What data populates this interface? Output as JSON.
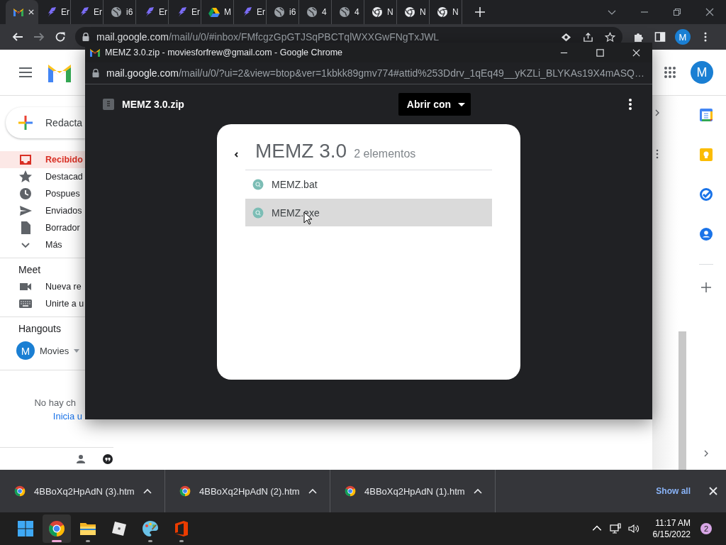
{
  "browser": {
    "tabs": [
      {
        "kind": "gmail",
        "selected": true
      },
      {
        "kind": "feather",
        "title": "Er",
        "selected": false
      },
      {
        "kind": "feather",
        "title": "Er",
        "selected": false
      },
      {
        "kind": "globe",
        "title": "i6",
        "selected": false
      },
      {
        "kind": "feather",
        "title": "Er",
        "selected": false
      },
      {
        "kind": "feather",
        "title": "Er",
        "selected": false
      },
      {
        "kind": "drive",
        "title": "M",
        "selected": false
      },
      {
        "kind": "feather",
        "title": "Er",
        "selected": false
      },
      {
        "kind": "globe",
        "title": "i6",
        "selected": false
      },
      {
        "kind": "globe",
        "title": "4",
        "selected": false
      },
      {
        "kind": "globe",
        "title": "4",
        "selected": false
      },
      {
        "kind": "chrome",
        "title": "N",
        "selected": false
      },
      {
        "kind": "chrome",
        "title": "N",
        "selected": false
      },
      {
        "kind": "chrome",
        "title": "N",
        "selected": false
      }
    ],
    "url": {
      "host": "mail.google.com",
      "path": "/mail/u/0/#inbox/FMfcgzGpGTJSqPBCTqlWXXGwFNgTxJWL"
    },
    "profile": "M"
  },
  "gmail": {
    "compose": "Redacta",
    "nav": [
      {
        "label": "Recibido",
        "kind": "inbox",
        "selected": true
      },
      {
        "label": "Destacad",
        "kind": "star",
        "selected": false
      },
      {
        "label": "Pospues",
        "kind": "clock",
        "selected": false
      },
      {
        "label": "Enviados",
        "kind": "send",
        "selected": false
      },
      {
        "label": "Borrador",
        "kind": "draft",
        "selected": false
      },
      {
        "label": "Más",
        "kind": "chevron",
        "selected": false
      }
    ],
    "meet": {
      "heading": "Meet",
      "items": [
        {
          "label": "Nueva re",
          "kind": "video"
        },
        {
          "label": "Unirte a u",
          "kind": "keyboard"
        }
      ]
    },
    "hangouts": {
      "heading": "Hangouts",
      "user_initial": "M",
      "user": "Movies",
      "empty_text": "No hay ch",
      "link": "Inicia u"
    },
    "account_initial": "M"
  },
  "popup": {
    "title": "MEMZ 3.0.zip - moviesforfrew@gmail.com - Google Chrome",
    "url": {
      "host": "mail.google.com",
      "path": "/mail/u/0/?ui=2&view=btop&ver=1kbkk89gmv774#attid%253Ddrv_1qEq49__yKZLi_BLYKAs19X4mASQ…"
    },
    "file_name": "MEMZ 3.0.zip",
    "open_with": "Abrir con",
    "folder": {
      "name": "MEMZ 3.0",
      "count": "2 elementos",
      "items": [
        {
          "name": "MEMZ.bat",
          "selected": false
        },
        {
          "name": "MEMZ.exe",
          "selected": true
        }
      ]
    }
  },
  "downloads": {
    "items": [
      "4BBoXq2HpAdN (3).htm",
      "4BBoXq2HpAdN (2).htm",
      "4BBoXq2HpAdN (1).htm"
    ],
    "show_all": "Show all"
  },
  "taskbar": {
    "apps": [
      {
        "kind": "start",
        "selected": false,
        "running": false
      },
      {
        "kind": "chrome",
        "selected": true,
        "running": true
      },
      {
        "kind": "folder",
        "selected": false,
        "running": true
      },
      {
        "kind": "cube",
        "selected": false,
        "running": false
      },
      {
        "kind": "palette",
        "selected": false,
        "running": true
      },
      {
        "kind": "office",
        "selected": false,
        "running": true
      }
    ],
    "time": "11:17 AM",
    "date": "6/15/2022",
    "notifications": "2"
  }
}
